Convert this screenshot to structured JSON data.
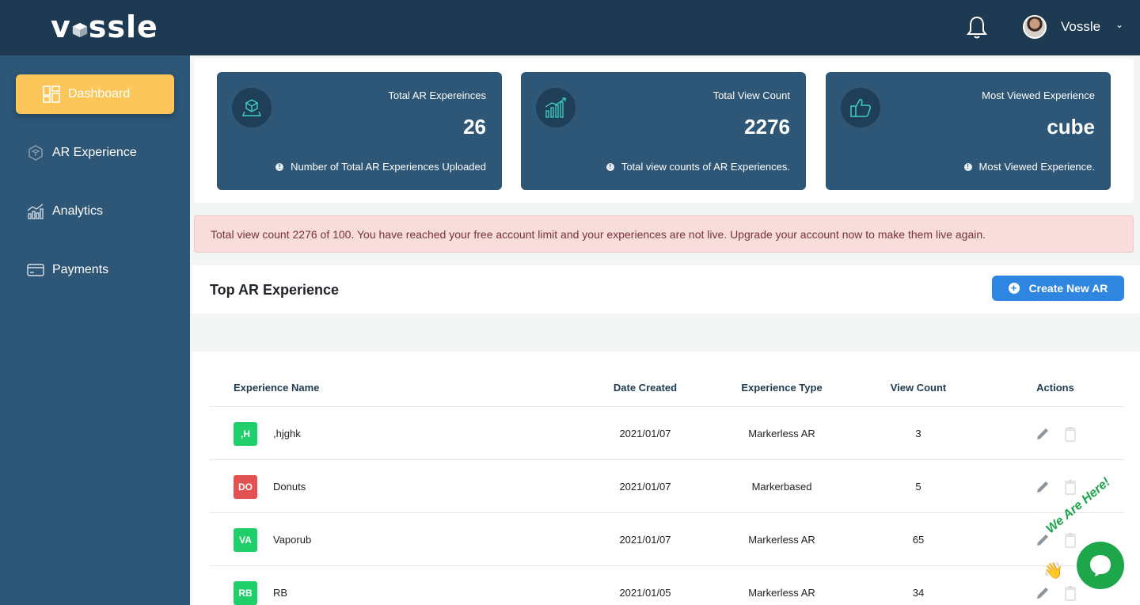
{
  "brand": {
    "logo_text": "vssle",
    "logo_prefix": "v",
    "logo_suffix": "ssle"
  },
  "header": {
    "user_name": "Vossle"
  },
  "sidebar": {
    "items": [
      {
        "label": "Dashboard",
        "icon": "dashboard-grid-icon",
        "active": true
      },
      {
        "label": "AR Experience",
        "icon": "cube-hex-icon"
      },
      {
        "label": "Analytics",
        "icon": "chart-bars-icon"
      },
      {
        "label": "Payments",
        "icon": "credit-card-icon"
      }
    ]
  },
  "stats": [
    {
      "title": "Total AR Expereinces",
      "value": "26",
      "note": "Number of Total AR Experiences Uploaded",
      "icon": "ar-box-icon"
    },
    {
      "title": "Total View Count",
      "value": "2276",
      "note": "Total view counts of AR Experiences.",
      "icon": "growth-chart-icon"
    },
    {
      "title": "Most Viewed Experience",
      "value": "cube",
      "note": "Most Viewed Experience.",
      "icon": "thumbs-up-icon"
    }
  ],
  "alert": {
    "text": "Total view count 2276 of 100. You have reached your free account limit and your experiences are not live. Upgrade your account now to make them live again."
  },
  "top_section": {
    "title": "Top AR Experience",
    "create_button": "Create New AR"
  },
  "table": {
    "headers": [
      "Experience Name",
      "Date Created",
      "Experience Type",
      "View Count",
      "Actions"
    ],
    "rows": [
      {
        "badge": ",H",
        "badge_color": "#1fcf6a",
        "name": ",hjghk",
        "date": "2021/01/07",
        "type": "Markerless AR",
        "views": "3"
      },
      {
        "badge": "DO",
        "badge_color": "#e25252",
        "name": "Donuts",
        "date": "2021/01/07",
        "type": "Markerbased",
        "views": "5"
      },
      {
        "badge": "VA",
        "badge_color": "#1fcf6a",
        "name": "Vaporub",
        "date": "2021/01/07",
        "type": "Markerless AR",
        "views": "65"
      },
      {
        "badge": "RB",
        "badge_color": "#1fcf6a",
        "name": "RB",
        "date": "2021/01/05",
        "type": "Markerless AR",
        "views": "34"
      }
    ]
  },
  "chat": {
    "label": "We Are Here!"
  },
  "colors": {
    "header_bg": "#1e3a52",
    "sidebar_bg": "#2d5677",
    "active_nav": "#fcc65a",
    "primary_button": "#2f86e0",
    "alert_bg": "#f9dcdc",
    "chat_green": "#1ea64a"
  }
}
